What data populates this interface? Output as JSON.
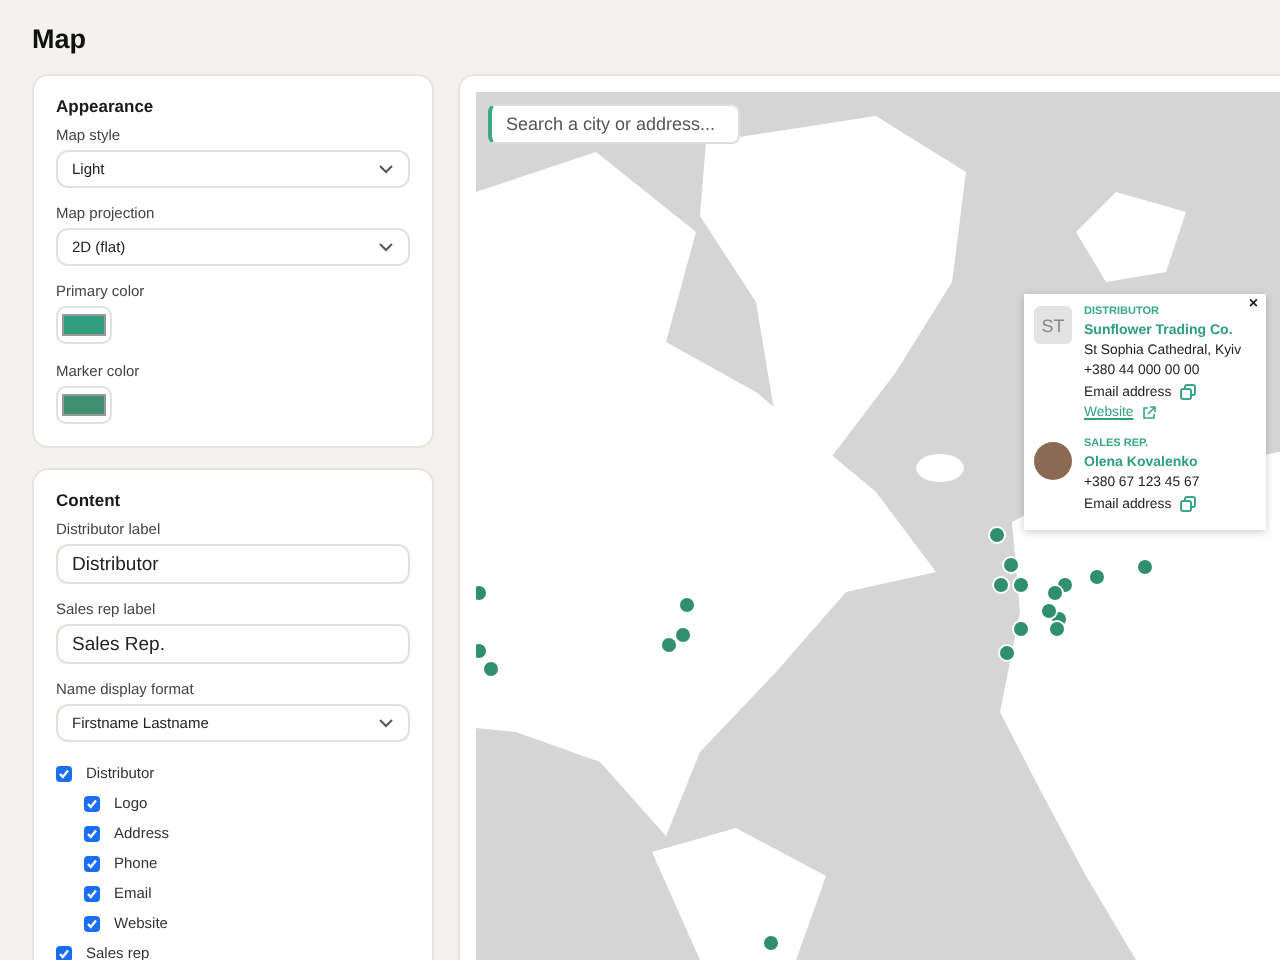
{
  "page": {
    "title": "Map"
  },
  "appearance": {
    "heading": "Appearance",
    "fields": [
      {
        "kind": "select",
        "label": "Map style",
        "value": "Light"
      },
      {
        "kind": "select",
        "label": "Map projection",
        "value": "2D (flat)"
      },
      {
        "kind": "color",
        "label": "Primary color",
        "color": "#2f9e7f"
      },
      {
        "kind": "color",
        "label": "Marker color",
        "color": "#3f8f72"
      }
    ]
  },
  "content": {
    "heading": "Content",
    "fields": [
      {
        "kind": "text",
        "label": "Distributor label",
        "value": "Distributor"
      },
      {
        "kind": "text",
        "label": "Sales rep label",
        "value": "Sales Rep."
      },
      {
        "kind": "select",
        "label": "Name display format",
        "value": "Firstname Lastname"
      }
    ],
    "options": [
      {
        "label": "Distributor",
        "checked": true,
        "children": [
          {
            "label": "Logo",
            "checked": true
          },
          {
            "label": "Address",
            "checked": true
          },
          {
            "label": "Phone",
            "checked": true
          },
          {
            "label": "Email",
            "checked": true
          },
          {
            "label": "Website",
            "checked": true
          }
        ]
      },
      {
        "label": "Sales rep",
        "checked": true
      }
    ]
  },
  "map": {
    "search": {
      "placeholder": "Search a city or address..."
    },
    "popup": {
      "close": "×",
      "distributor": {
        "logo": "ST",
        "role": "DISTRIBUTOR",
        "name": "Sunflower Trading Co.",
        "address": "St Sophia Cathedral, Kyiv",
        "phone": "+380 44 000 00 00",
        "email": "Email address",
        "website": "Website"
      },
      "sales_rep": {
        "role": "SALES REP.",
        "name": "Olena Kovalenko",
        "phone": "+380 67 123 45 67",
        "email": "Email address"
      }
    }
  }
}
